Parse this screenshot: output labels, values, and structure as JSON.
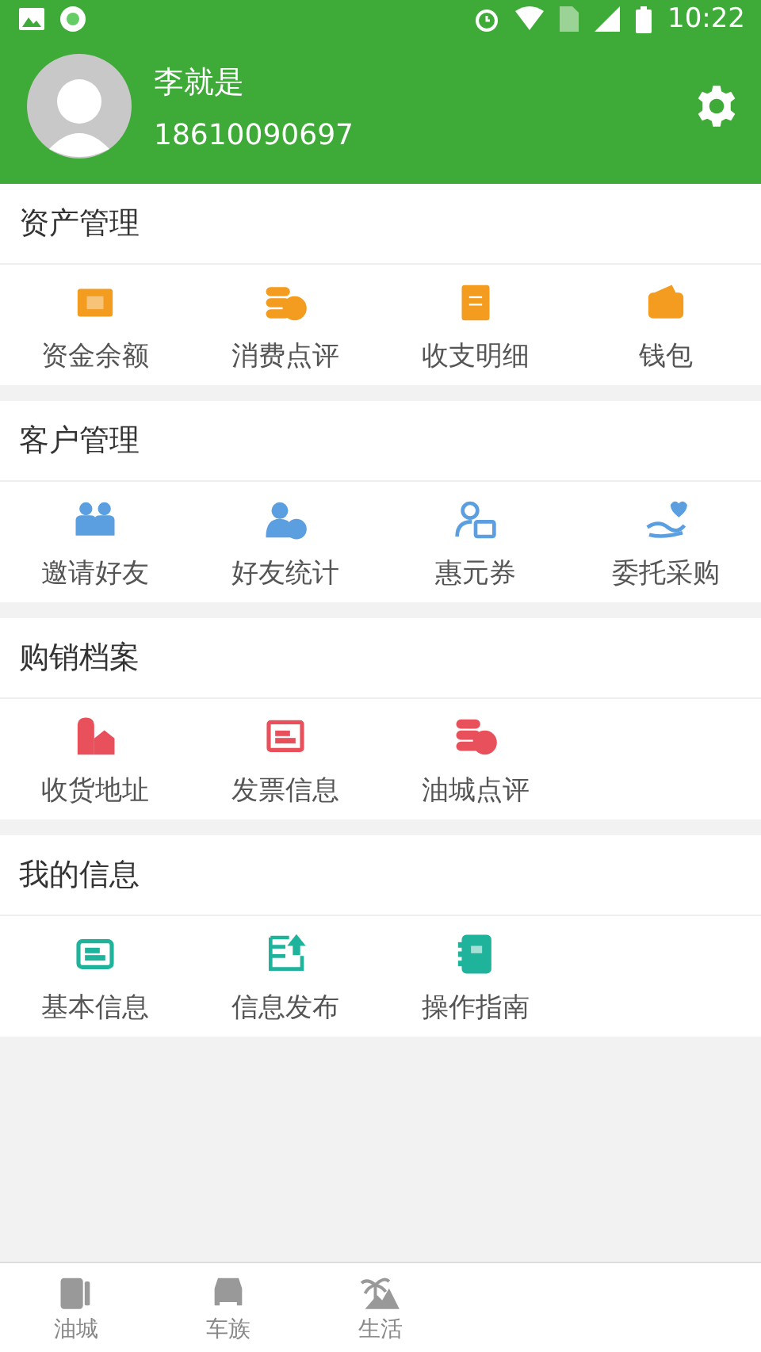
{
  "status_bar": {
    "time": "10:22"
  },
  "profile": {
    "name": "李就是",
    "phone": "18610090697"
  },
  "sections": [
    {
      "title": "资产管理",
      "color": "#f39c1f",
      "items": [
        "资金余额",
        "消费点评",
        "收支明细",
        "钱包"
      ]
    },
    {
      "title": "客户管理",
      "color": "#5b9fe0",
      "items": [
        "邀请好友",
        "好友统计",
        "惠元券",
        "委托采购"
      ]
    },
    {
      "title": "购销档案",
      "color": "#e8505b",
      "items": [
        "收货地址",
        "发票信息",
        "油城点评"
      ]
    },
    {
      "title": "我的信息",
      "color": "#1fb39c",
      "items": [
        "基本信息",
        "信息发布",
        "操作指南"
      ]
    }
  ],
  "tab_bar": [
    {
      "label": "油城"
    },
    {
      "label": "车族"
    },
    {
      "label": "生活"
    }
  ]
}
